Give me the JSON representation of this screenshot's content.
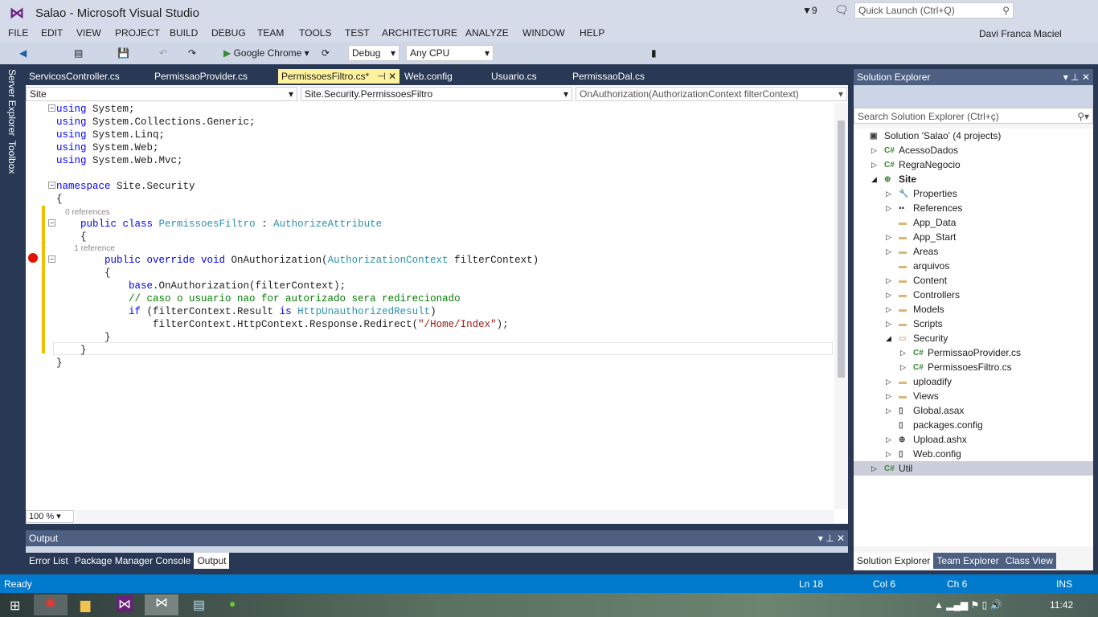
{
  "title": "Salao - Microsoft Visual Studio",
  "notifications": "9",
  "quick_launch": "Quick Launch (Ctrl+Q)",
  "user": "Davi Franca Maciel",
  "menu": [
    "FILE",
    "EDIT",
    "VIEW",
    "PROJECT",
    "BUILD",
    "DEBUG",
    "TEAM",
    "TOOLS",
    "TEST",
    "ARCHITECTURE",
    "ANALYZE",
    "WINDOW",
    "HELP"
  ],
  "toolbar": {
    "run": "Google Chrome",
    "config": "Debug",
    "platform": "Any CPU"
  },
  "side_tabs": [
    "Server Explorer",
    "Toolbox"
  ],
  "tabs": [
    {
      "label": "ServicosController.cs"
    },
    {
      "label": "PermissaoProvider.cs"
    },
    {
      "label": "PermissoesFiltro.cs*",
      "active": true
    },
    {
      "label": "Web.config"
    },
    {
      "label": "Usuario.cs"
    },
    {
      "label": "PermissaoDal.cs"
    }
  ],
  "nav": {
    "project": "Site",
    "type": "Site.Security.PermissoesFiltro",
    "member": "OnAuthorization(AuthorizationContext filterContext)"
  },
  "code": [
    [
      [
        "using",
        "kw"
      ],
      [
        " System;",
        ""
      ]
    ],
    [
      [
        "using",
        "kw"
      ],
      [
        " System.Collections.Generic;",
        ""
      ]
    ],
    [
      [
        "using",
        "kw"
      ],
      [
        " System.Linq;",
        ""
      ]
    ],
    [
      [
        "using",
        "kw"
      ],
      [
        " System.Web;",
        ""
      ]
    ],
    [
      [
        "using",
        "kw"
      ],
      [
        " System.Web.Mvc;",
        ""
      ]
    ],
    [],
    [
      [
        "namespace",
        "kw"
      ],
      [
        " Site.Security",
        ""
      ]
    ],
    [
      [
        "{",
        ""
      ]
    ],
    [
      [
        "    0 references",
        "ref"
      ]
    ],
    [
      [
        "    ",
        ""
      ],
      [
        "public class",
        "kw"
      ],
      [
        " ",
        ""
      ],
      [
        "PermissoesFiltro",
        "ty"
      ],
      [
        " : ",
        ""
      ],
      [
        "AuthorizeAttribute",
        "ty"
      ]
    ],
    [
      [
        "    {",
        ""
      ]
    ],
    [
      [
        "        1 reference",
        "ref"
      ]
    ],
    [
      [
        "        ",
        ""
      ],
      [
        "public override void",
        "kw"
      ],
      [
        " OnAuthorization(",
        ""
      ],
      [
        "AuthorizationContext",
        "ty"
      ],
      [
        " filterContext)",
        ""
      ]
    ],
    [
      [
        "        {",
        ""
      ]
    ],
    [
      [
        "            ",
        ""
      ],
      [
        "base",
        "kw"
      ],
      [
        ".OnAuthorization(filterContext);",
        ""
      ]
    ],
    [
      [
        "            // caso o usuario nao for autorizado sera redirecionado",
        "cm"
      ]
    ],
    [
      [
        "            ",
        ""
      ],
      [
        "if",
        "kw"
      ],
      [
        " (filterContext.Result ",
        ""
      ],
      [
        "is",
        "kw"
      ],
      [
        " ",
        ""
      ],
      [
        "HttpUnauthorizedResult",
        "ty"
      ],
      [
        ")",
        ""
      ]
    ],
    [
      [
        "                filterContext.HttpContext.Response.Redirect(",
        ""
      ],
      [
        "\"/Home/Index\"",
        "st"
      ],
      [
        ");",
        ""
      ]
    ],
    [
      [
        "        }",
        ""
      ]
    ],
    [
      [
        "    }",
        ""
      ]
    ],
    [
      [
        "}",
        ""
      ]
    ]
  ],
  "zoom": "100 %",
  "output": {
    "title": "Output",
    "tabs": [
      "Error List",
      "Package Manager Console",
      "Output"
    ]
  },
  "solution_explorer": {
    "title": "Solution Explorer",
    "search": "Search Solution Explorer (Ctrl+ç)",
    "items": [
      {
        "label": "Solution 'Salao' (4 projects)",
        "level": 0,
        "icon": "solution-icon"
      },
      {
        "label": "AcessoDados",
        "level": 1,
        "icon": "csharp-project-icon",
        "exp": "collapsed"
      },
      {
        "label": "RegraNegocio",
        "level": 1,
        "icon": "csharp-project-icon",
        "exp": "collapsed"
      },
      {
        "label": "Site",
        "level": 1,
        "icon": "web-project-icon",
        "exp": "expanded",
        "bold": true
      },
      {
        "label": "Properties",
        "level": 2,
        "icon": "wrench-icon",
        "exp": "collapsed"
      },
      {
        "label": "References",
        "level": 2,
        "icon": "references-icon",
        "exp": "collapsed"
      },
      {
        "label": "App_Data",
        "level": 2,
        "icon": "folder-icon"
      },
      {
        "label": "App_Start",
        "level": 2,
        "icon": "folder-icon",
        "exp": "collapsed"
      },
      {
        "label": "Areas",
        "level": 2,
        "icon": "folder-icon",
        "exp": "collapsed"
      },
      {
        "label": "arquivos",
        "level": 2,
        "icon": "folder-icon"
      },
      {
        "label": "Content",
        "level": 2,
        "icon": "folder-icon",
        "exp": "collapsed"
      },
      {
        "label": "Controllers",
        "level": 2,
        "icon": "folder-icon",
        "exp": "collapsed"
      },
      {
        "label": "Models",
        "level": 2,
        "icon": "folder-icon",
        "exp": "collapsed"
      },
      {
        "label": "Scripts",
        "level": 2,
        "icon": "folder-icon",
        "exp": "collapsed"
      },
      {
        "label": "Security",
        "level": 2,
        "icon": "folder-open-icon",
        "exp": "expanded"
      },
      {
        "label": "PermissaoProvider.cs",
        "level": 3,
        "icon": "csharp-file-icon",
        "exp": "collapsed"
      },
      {
        "label": "PermissoesFiltro.cs",
        "level": 3,
        "icon": "csharp-file-icon",
        "exp": "collapsed"
      },
      {
        "label": "uploadify",
        "level": 2,
        "icon": "folder-icon",
        "exp": "collapsed"
      },
      {
        "label": "Views",
        "level": 2,
        "icon": "folder-icon",
        "exp": "collapsed"
      },
      {
        "label": "Global.asax",
        "level": 2,
        "icon": "file-icon",
        "exp": "collapsed"
      },
      {
        "label": "packages.config",
        "level": 2,
        "icon": "file-icon"
      },
      {
        "label": "Upload.ashx",
        "level": 2,
        "icon": "globe-file-icon",
        "exp": "collapsed"
      },
      {
        "label": "Web.config",
        "level": 2,
        "icon": "file-icon",
        "exp": "collapsed"
      },
      {
        "label": "Util",
        "level": 1,
        "icon": "csharp-project-icon",
        "exp": "collapsed",
        "selected": true
      }
    ],
    "bottom_tabs": [
      "Solution Explorer",
      "Team Explorer",
      "Class View"
    ]
  },
  "status": {
    "ready": "Ready",
    "ln": "Ln 18",
    "col": "Col 6",
    "ch": "Ch 6",
    "ins": "INS"
  },
  "clock": "11:42",
  "colors": {
    "accent": "#007acc",
    "frame": "#293955",
    "active_tab": "#fff29d",
    "breakpoint": "#e51400"
  }
}
